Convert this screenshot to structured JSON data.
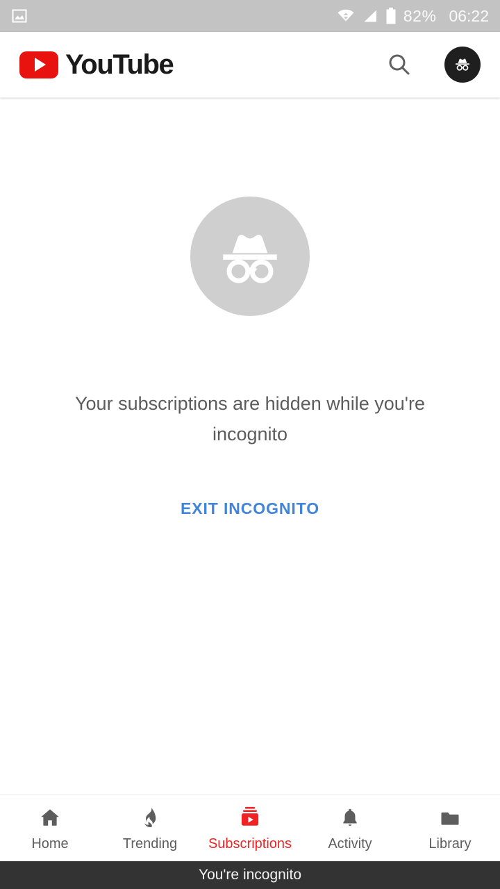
{
  "status_bar": {
    "background": "#c3c3c3",
    "left_icons": [
      {
        "name": "screenshot-image-icon",
        "glyph": "image"
      }
    ],
    "right_icons": [
      {
        "name": "wifi-icon",
        "glyph": "wifi"
      },
      {
        "name": "cell-signal-icon",
        "glyph": "signal"
      },
      {
        "name": "battery-icon",
        "glyph": "battery"
      }
    ],
    "battery_percent": "82%",
    "time": "06:22"
  },
  "header": {
    "brand": "YouTube",
    "logo_color": "#e8130e",
    "search_label": "Search",
    "account_label": "Incognito account"
  },
  "main": {
    "illustration": "incognito-hat-glasses",
    "illustration_circle_color": "#cfcfcf",
    "empty_message": "Your subscriptions are hidden while you're incognito",
    "action_label": "EXIT INCOGNITO",
    "action_color": "#4285d8"
  },
  "bottom_nav": {
    "active_index": 2,
    "active_color": "#ef2323",
    "inactive_color": "#5e5e5e",
    "items": [
      {
        "label": "Home",
        "icon": "home-icon"
      },
      {
        "label": "Trending",
        "icon": "flame-icon"
      },
      {
        "label": "Subscriptions",
        "icon": "subscriptions-icon"
      },
      {
        "label": "Activity",
        "icon": "bell-icon"
      },
      {
        "label": "Library",
        "icon": "folder-icon"
      }
    ]
  },
  "incognito_banner": {
    "text": "You're incognito",
    "background": "#333333"
  }
}
